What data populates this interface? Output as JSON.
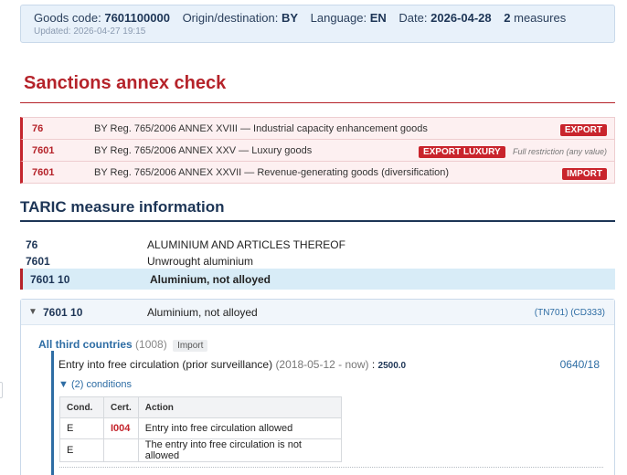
{
  "info": {
    "goods_label": "Goods code:",
    "goods_code": "7601100000",
    "origin_label": "Origin/destination:",
    "origin": "BY",
    "language_label": "Language:",
    "language": "EN",
    "date_label": "Date:",
    "date": "2026-04-28",
    "measures_count": "2",
    "measures_label": "measures",
    "updated": "Updated: 2026-04-27 19:15"
  },
  "sanctions": {
    "title": "Sanctions annex check",
    "rows": [
      {
        "code": "76",
        "text": "BY Reg. 765/2006 ANNEX XVIII — Industrial capacity enhancement goods",
        "badge": "EXPORT",
        "note": ""
      },
      {
        "code": "7601",
        "text": "BY Reg. 765/2006 ANNEX XXV — Luxury goods",
        "badge": "EXPORT LUXURY",
        "note": "Full restriction (any value)"
      },
      {
        "code": "7601",
        "text": "BY Reg. 765/2006 ANNEX XXVII — Revenue-generating goods (diversification)",
        "badge": "IMPORT",
        "note": ""
      }
    ]
  },
  "taric": {
    "title": "TARIC measure information",
    "tree": [
      {
        "code": "76",
        "desc": "ALUMINIUM AND ARTICLES THEREOF"
      },
      {
        "code": "7601",
        "desc": "Unwrought aluminium"
      },
      {
        "code": "7601 10",
        "desc": "Aluminium, not alloyed"
      }
    ]
  },
  "measure": {
    "arrow": "▼",
    "code": "7601 10",
    "desc": "Aluminium, not alloyed",
    "refs": "(TN701) (CD333)",
    "geo_name": "All third countries",
    "geo_count": "(1008)",
    "geo_badge": "Import",
    "type": "Entry into free circulation (prior surveillance)",
    "dates": "(2018-05-12 - now)",
    "sep": ":",
    "value": "2500.0",
    "regulation": "0640/18",
    "conditions_toggle": "▼ (2) conditions",
    "cond_headers": {
      "cond": "Cond.",
      "cert": "Cert.",
      "action": "Action"
    },
    "conditions": [
      {
        "cond": "E",
        "cert": "I004",
        "action": "Entry into free circulation allowed"
      },
      {
        "cond": "E",
        "cert": "",
        "action": "The entry into free circulation is not allowed"
      }
    ]
  },
  "colors": {
    "sanction_red": "#c9242c",
    "navy": "#1d3556",
    "link_blue": "#2e6da4",
    "selected_bg": "#d8ecf7"
  }
}
